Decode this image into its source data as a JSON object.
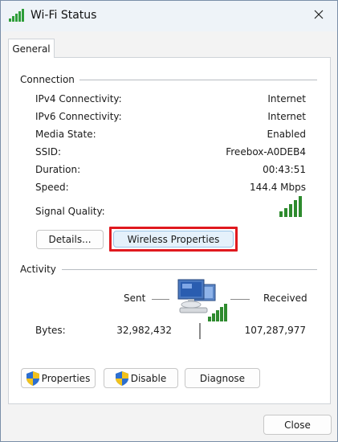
{
  "window": {
    "title": "Wi-Fi Status",
    "title_icon": "wifi-signal-icon",
    "close_icon": "close-icon"
  },
  "tabs": [
    {
      "label": "General",
      "selected": true
    }
  ],
  "connection": {
    "heading": "Connection",
    "rows": [
      {
        "label": "IPv4 Connectivity:",
        "value": "Internet"
      },
      {
        "label": "IPv6 Connectivity:",
        "value": "Internet"
      },
      {
        "label": "Media State:",
        "value": "Enabled"
      },
      {
        "label": "SSID:",
        "value": "Freebox-A0DEB4"
      },
      {
        "label": "Duration:",
        "value": "00:43:51"
      },
      {
        "label": "Speed:",
        "value": "144.4 Mbps"
      }
    ],
    "signal_label": "Signal Quality:",
    "signal_bars": 5,
    "signal_bars_filled": 5,
    "details_label": "Details...",
    "wireless_properties_label": "Wireless Properties"
  },
  "activity": {
    "heading": "Activity",
    "sent_label": "Sent",
    "received_label": "Received",
    "bytes_label": "Bytes:",
    "bytes_sent": "32,982,432",
    "bytes_received": "107,287,977",
    "network_icon": "network-computers-icon"
  },
  "actions": {
    "properties_label": "Properties",
    "disable_label": "Disable",
    "diagnose_label": "Diagnose",
    "shield_icon": "uac-shield-icon"
  },
  "footer": {
    "close_label": "Close"
  },
  "colors": {
    "accent_button": "#e5f1fb",
    "highlight": "#e0191f",
    "signal_green": "#2e8b2e"
  }
}
